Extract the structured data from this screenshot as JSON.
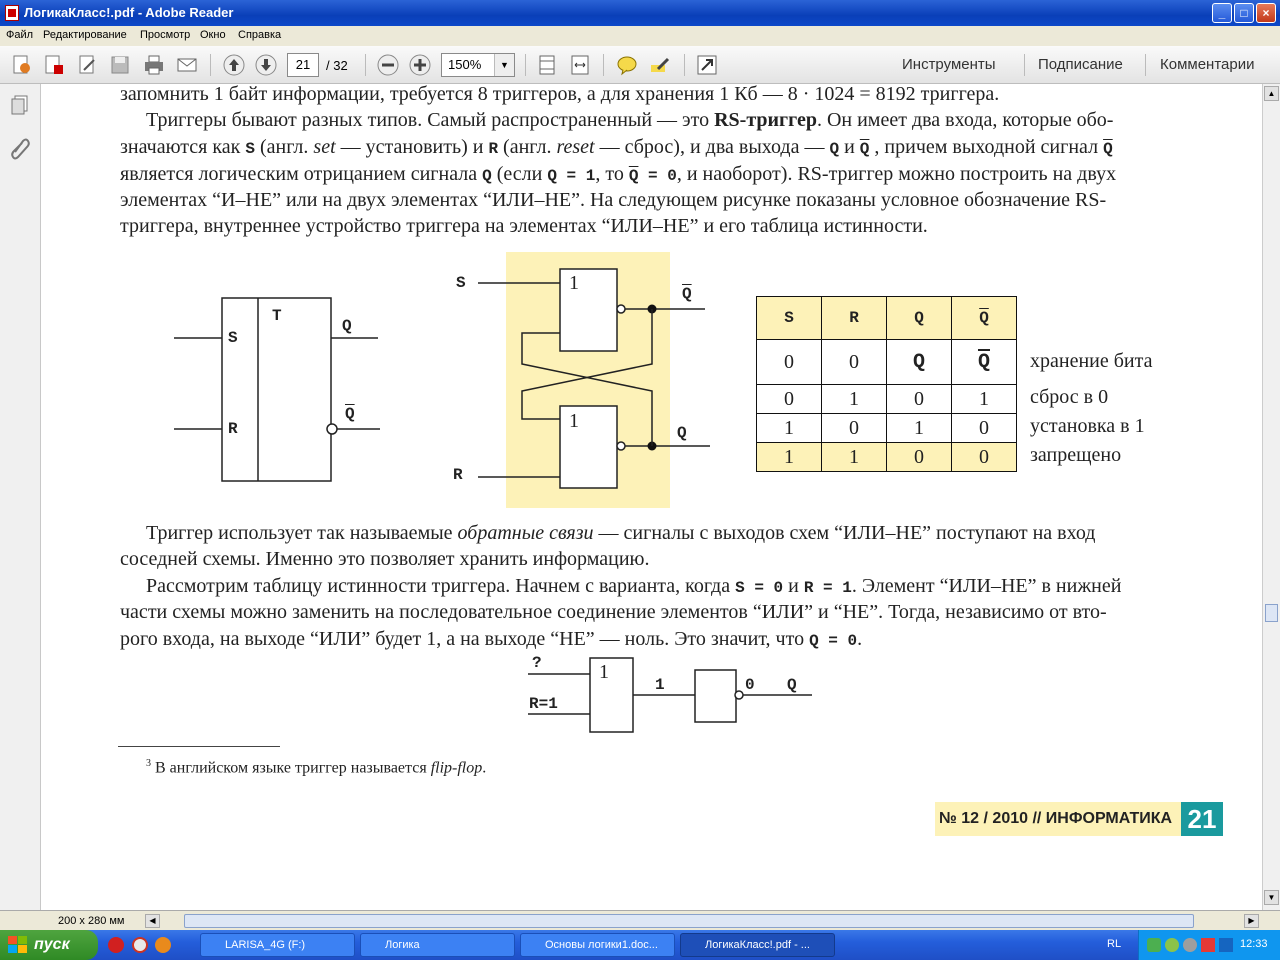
{
  "window": {
    "title": "ЛогикаКласс!.pdf - Adobe Reader",
    "minimize_glyph": "_",
    "maximize_glyph": "□",
    "close_glyph": "×"
  },
  "menu": [
    "Файл",
    "Редактирование",
    "Просмотр",
    "Окно",
    "Справка"
  ],
  "toolbar": {
    "page_current": "21",
    "page_total": "/ 32",
    "zoom": "150%",
    "tools_label": "Инструменты",
    "sign_label": "Подписание",
    "comment_label": "Комментарии"
  },
  "document": {
    "line_top": "запомнить 1 байт информации, требуется 8 триггеров, а для хранения 1 Кб — 8 · 1024 = 8192 триггера.",
    "p1": {
      "l1a": "Триггеры бывают разных типов. Самый распространенный — это ",
      "l1b": "RS-триггер",
      "l1c": ". Он имеет два входа, которые обо-",
      "l2a": "значаются как ",
      "l2s": "S",
      "l2b": " (англ. ",
      "l2set": "set",
      "l2c": " — установить) и ",
      "l2r": "R",
      "l2d": " (англ. ",
      "l2reset": "reset",
      "l2e": " — сброс), и два выхода — ",
      "l2q": "Q",
      "l2f": " и ",
      "l2qb": "Q",
      "l2g": " , причем выходной сигнал ",
      "l2qb2": "Q",
      "l3a": "является логическим отрицанием сигнала ",
      "l3q": "Q",
      "l3b": "  (если ",
      "l3q1": "Q = 1",
      "l3c": ", то ",
      "l3qb": "Q",
      "l3d": " = 0",
      "l3e": ", и наоборот). RS-триггер можно построить на двух",
      "l4": "элементах “И–НЕ” или на двух элементах “ИЛИ–НЕ”. На следующем рисунке показаны условное обозначение RS-",
      "l5": "триггера, внутреннее устройство триггера на элементах “ИЛИ–НЕ” и его таблица истинности."
    },
    "fig1": {
      "t": "T",
      "s": "S",
      "r": "R",
      "q": "Q",
      "qbar": "Q"
    },
    "fig2": {
      "s": "S",
      "r": "R",
      "q": "Q",
      "qbar": "Q",
      "gate_top": "1",
      "gate_bottom": "1"
    },
    "truth_table": {
      "headers": [
        "S",
        "R",
        "Q",
        "Q"
      ],
      "rows": [
        [
          "0",
          "0",
          "Q",
          "Q"
        ],
        [
          "0",
          "1",
          "0",
          "1"
        ],
        [
          "1",
          "0",
          "1",
          "0"
        ],
        [
          "1",
          "1",
          "0",
          "0"
        ]
      ],
      "notes": [
        "хранение бита",
        "сброс в 0",
        "установка в 1",
        "запрещено"
      ]
    },
    "p2": {
      "l1a": "Триггер использует так называемые ",
      "l1b": "обратные связи",
      "l1c": " — сигналы с выходов схем “ИЛИ–НЕ” поступают на вход",
      "l2": "соседней схемы. Именно это позволяет хранить информацию."
    },
    "p3": {
      "l1a": "Рассмотрим таблицу истинности триггера. Начнем с варианта, когда ",
      "l1s": "S = 0",
      "l1b": " и ",
      "l1r": "R = 1",
      "l1c": ". Элемент “ИЛИ–НЕ” в нижней",
      "l2": "части схемы можно заменить на последовательное соединение элементов “ИЛИ” и “НЕ”. Тогда, независимо от вто-",
      "l3a": "рого входа, на выходе “ИЛИ” будет 1, а на выходе “НЕ” — ноль. Это значит, что ",
      "l3q": "Q = 0",
      "l3b": "."
    },
    "fig3": {
      "in1": "?",
      "in2": "R=1",
      "gate": "1",
      "mid": "1",
      "out": "0",
      "q": "Q"
    },
    "footnote": {
      "mark": "3",
      "text": " В английском языке триггер называется ",
      "term": "flip-flop",
      "end": "."
    },
    "badge": {
      "text": "№ 12 / 2010 // ИНФОРМАТИКА",
      "page": "21"
    }
  },
  "statusbar": {
    "page_size": "200 x 280 мм"
  },
  "taskbar": {
    "start": "пуск",
    "items": [
      "LARISA_4G (F:)",
      "Логика",
      "Основы логики1.doc...",
      "ЛогикаКласс!.pdf - ..."
    ],
    "lang": "RL",
    "time": "12:33"
  },
  "colors": {
    "highlight": "#fdf2b8",
    "badge_teal": "#1a9a9e",
    "title_blue": "#0a3fb8"
  }
}
